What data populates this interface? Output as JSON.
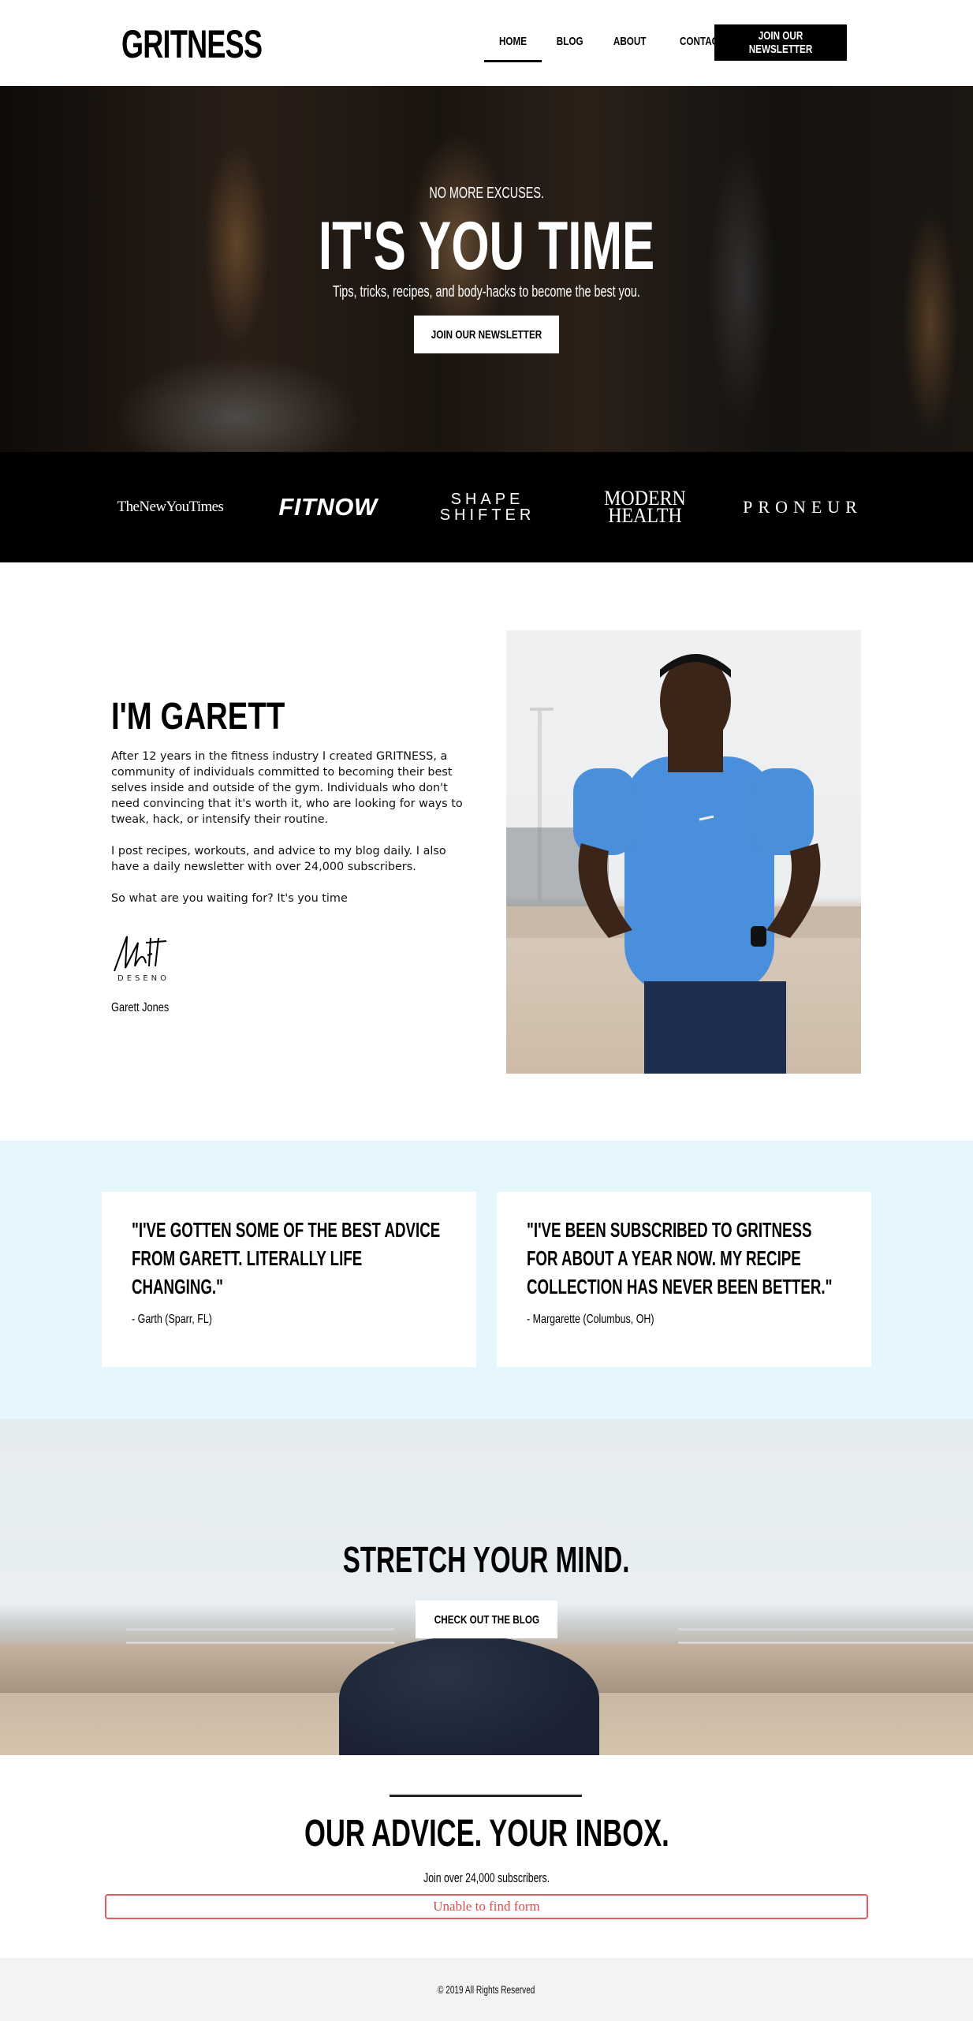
{
  "header": {
    "logo": "GRITNESS",
    "nav": [
      {
        "label": "HOME",
        "active": true
      },
      {
        "label": "BLOG",
        "active": false
      },
      {
        "label": "ABOUT",
        "active": false
      },
      {
        "label": "CONTACT",
        "active": false
      }
    ],
    "cta_label": "JOIN OUR NEWSLETTER"
  },
  "hero": {
    "eyebrow": "NO MORE EXCUSES.",
    "title": "IT'S YOU TIME",
    "subtitle": "Tips, tricks, recipes, and body-hacks to become the best you.",
    "cta_label": "JOIN OUR NEWSLETTER"
  },
  "press": {
    "logos": [
      "TheNewYouTimes",
      "FITNOW",
      "SHAPE\nSHIFTER",
      "MODERN\nHEALTH",
      "PRONEUR"
    ]
  },
  "about": {
    "title": "I'M GARETT",
    "paragraphs": [
      "After 12 years in the fitness industry I created GRITNESS, a community of individuals committed to becoming their best selves inside and outside of the gym. Individuals who don't need convincing that it's worth it, who are looking for ways to tweak, hack, or intensify their routine.",
      "I post recipes, workouts, and advice to my blog daily. I also have a daily newsletter with over 24,000 subscribers.",
      "So what are you waiting for? It's you time"
    ],
    "signature_text": "DESENO",
    "name": "Garett Jones"
  },
  "testimonials": [
    {
      "quote": "\"I'VE GOTTEN SOME OF THE BEST ADVICE FROM GARETT. LITERALLY LIFE CHANGING.\"",
      "author": "- Garth (Sparr, FL)"
    },
    {
      "quote": "\"I'VE BEEN SUBSCRIBED TO GRITNESS FOR ABOUT A YEAR NOW. MY RECIPE COLLECTION HAS NEVER BEEN BETTER.\"",
      "author": "- Margarette (Columbus, OH)"
    }
  ],
  "stretch": {
    "title": "STRETCH YOUR MIND.",
    "cta_label": "CHECK OUT THE BLOG"
  },
  "newsletter": {
    "title": "OUR ADVICE. YOUR INBOX.",
    "subtitle": "Join over 24,000 subscribers.",
    "form_error": "Unable to find form"
  },
  "footer": {
    "copyright": "© 2019 All Rights Reserved"
  },
  "colors": {
    "testimonial_bg": "#e6f6fd",
    "error": "#e05b5b",
    "footer_bg": "#f3f3f3"
  }
}
